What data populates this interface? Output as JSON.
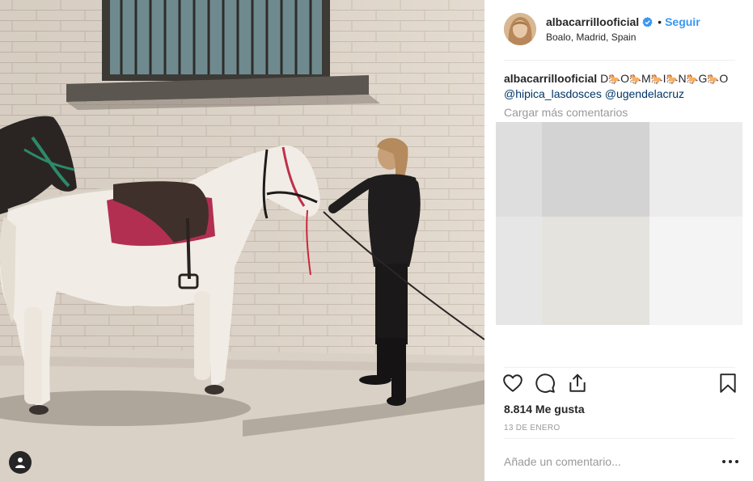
{
  "post": {
    "username": "albacarrillooficial",
    "verified": true,
    "separator": "•",
    "follow_label": "Seguir",
    "location": "Boalo, Madrid, Spain"
  },
  "caption": {
    "username": "albacarrillooficial",
    "letters": [
      "D",
      "O",
      "M",
      "I",
      "N",
      "G",
      "O"
    ],
    "emoji": "🐎",
    "mention_1": "@hipica_lasdosces",
    "mention_2": "@ugendelacruz"
  },
  "comments": {
    "load_more_label": "Cargar más comentarios",
    "placeholder_tile_colors": [
      "#dedede",
      "#d3d3d3",
      "#ececec",
      "#e6e6e6",
      "#e5e3de",
      "#f4f4f4"
    ]
  },
  "actions": {
    "like_icon": "heart-icon",
    "comment_icon": "comment-icon",
    "share_icon": "share-icon",
    "save_icon": "bookmark-icon"
  },
  "likes_label": "8.814 Me gusta",
  "date_label": "13 DE ENERO",
  "comment_placeholder": "Añade un comentario...",
  "colors": {
    "accent": "#3897f0",
    "mention": "#003569",
    "muted": "#999999",
    "text": "#262626"
  }
}
